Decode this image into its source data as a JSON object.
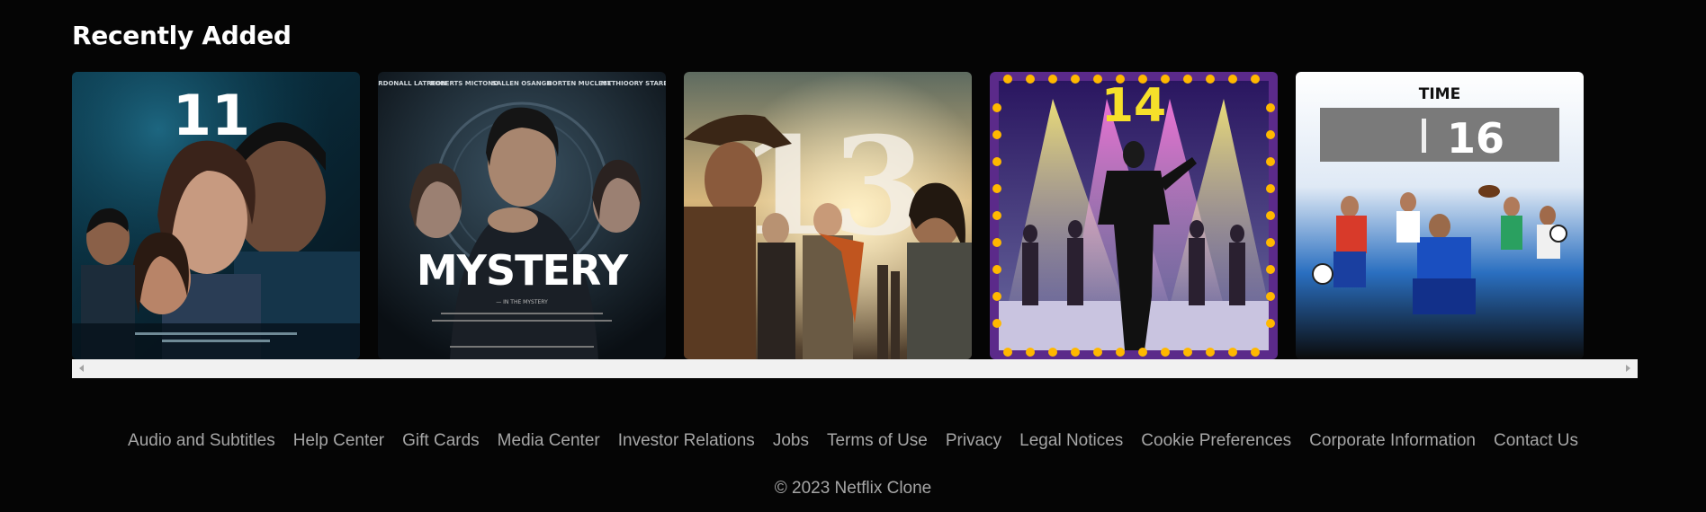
{
  "section": {
    "title": "Recently Added"
  },
  "posters": [
    {
      "number": "11",
      "alt": "Drama poster 11"
    },
    {
      "number": "",
      "title": "MYSTERY",
      "top_names": [
        "MARDONALL LATREON",
        "ROBERTS MICTONO",
        "SALLEN OSANGH",
        "BORTEN MUCLEST",
        "METHIOORY STAREER"
      ],
      "tagline": "— IN THE MYSTERY"
    },
    {
      "number": "13"
    },
    {
      "number": "14"
    },
    {
      "number": "16",
      "brand": "TIME"
    }
  ],
  "footer": {
    "links": [
      "Audio and Subtitles",
      "Help Center",
      "Gift Cards",
      "Media Center",
      "Investor Relations",
      "Jobs",
      "Terms of Use",
      "Privacy",
      "Legal Notices",
      "Cookie Preferences",
      "Corporate Information",
      "Contact Us"
    ],
    "copyright": "© 2023 Netflix Clone"
  }
}
